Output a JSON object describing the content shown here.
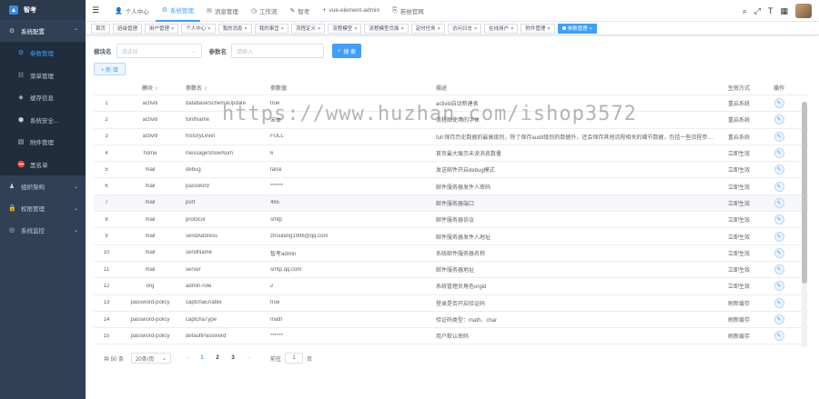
{
  "app": {
    "logo_text": "智考"
  },
  "sidebar": {
    "items": [
      {
        "label": "系统配置",
        "icon": "gear-icon",
        "type": "group-open"
      },
      {
        "label": "参数管理",
        "icon": "settings-icon",
        "type": "sub-active"
      },
      {
        "label": "菜单管理",
        "icon": "list-icon",
        "type": "sub"
      },
      {
        "label": "缓存信息",
        "icon": "cache-icon",
        "type": "sub"
      },
      {
        "label": "系统安全...",
        "icon": "shield-icon",
        "type": "sub"
      },
      {
        "label": "附件管理",
        "icon": "file-icon",
        "type": "sub"
      },
      {
        "label": "黑名单",
        "icon": "blacklist-icon",
        "type": "sub"
      },
      {
        "label": "组织架构",
        "icon": "org-icon",
        "type": "group"
      },
      {
        "label": "权限管理",
        "icon": "lock-icon",
        "type": "group"
      },
      {
        "label": "系统监控",
        "icon": "monitor-icon",
        "type": "group"
      }
    ]
  },
  "topnav": {
    "items": [
      {
        "label": "个人中心",
        "icon": "user-icon"
      },
      {
        "label": "系统管理",
        "icon": "gear-icon",
        "active": true
      },
      {
        "label": "消息管理",
        "icon": "message-icon"
      },
      {
        "label": "工作流",
        "icon": "workflow-icon"
      },
      {
        "label": "智考",
        "icon": "exam-icon"
      },
      {
        "label": "vue-element-admin",
        "icon": "plus-icon"
      },
      {
        "label": "若依官网",
        "icon": "link-icon"
      }
    ]
  },
  "tags": [
    {
      "label": "首页",
      "closable": false
    },
    {
      "label": "班级管理",
      "closable": false
    },
    {
      "label": "用户管理",
      "closable": true
    },
    {
      "label": "个人中心",
      "closable": true
    },
    {
      "label": "我的消息",
      "closable": true
    },
    {
      "label": "我的事宜",
      "closable": true
    },
    {
      "label": "流程定义",
      "closable": true
    },
    {
      "label": "流程模型",
      "closable": true
    },
    {
      "label": "流程模型页面",
      "closable": true
    },
    {
      "label": "定时任务",
      "closable": true
    },
    {
      "label": "访问日志",
      "closable": true
    },
    {
      "label": "在线用户",
      "closable": true
    },
    {
      "label": "附件管理",
      "closable": true
    },
    {
      "label": "参数管理",
      "closable": true,
      "active": true
    }
  ],
  "search": {
    "module_label": "模块名",
    "module_placeholder": "请选择",
    "param_label": "参数名",
    "param_placeholder": "请输入",
    "search_button": "搜 索"
  },
  "add_button": "+ 新 增",
  "table": {
    "columns": [
      "",
      "模块",
      "参数名",
      "参数值",
      "描述",
      "生效方式",
      "操作"
    ],
    "rows": [
      [
        "1",
        "activiti",
        "databaseSchemaUpdate",
        "true",
        "activiti自动新建表",
        "重启系统"
      ],
      [
        "2",
        "activiti",
        "fontName",
        "宋体",
        "流程图使用的字体",
        "重启系统"
      ],
      [
        "3",
        "activiti",
        "historyLevel",
        "FULL",
        "full:保存历史数据的最高级别，除了保存audit级别的数据外，还会保存其他流程相关的细节数据，包括一些流程参数等。",
        "重启系统"
      ],
      [
        "4",
        "home",
        "messageShowNum",
        "6",
        "首页最大展示未读消息数量",
        "立即生效"
      ],
      [
        "5",
        "mail",
        "debug",
        "false",
        "发送邮件开启debug模式",
        "立即生效"
      ],
      [
        "6",
        "mail",
        "password",
        "******",
        "邮件服务器发件人密码",
        "立即生效"
      ],
      [
        "7",
        "mail",
        "port",
        "465",
        "邮件服务器端口",
        "立即生效"
      ],
      [
        "8",
        "mail",
        "protocol",
        "smtp",
        "邮件服务器协议",
        "立即生效"
      ],
      [
        "9",
        "mail",
        "sendAddress",
        "zhoulang1996@qq.com",
        "邮件服务器发件人地址",
        "立即生效"
      ],
      [
        "10",
        "mail",
        "sendName",
        "智考admin",
        "系统邮件服务器名称",
        "立即生效"
      ],
      [
        "11",
        "mail",
        "server",
        "smtp.qq.com",
        "邮件服务器地址",
        "立即生效"
      ],
      [
        "12",
        "org",
        "admin-role",
        "2",
        "系统管理员角色orgid",
        "立即生效"
      ],
      [
        "13",
        "password-policy",
        "captchaEnable",
        "true",
        "登录是否开启验证码",
        "刷新缓存"
      ],
      [
        "14",
        "password-policy",
        "captchaType",
        "math",
        "验证码类型：math、char",
        "刷新缓存"
      ],
      [
        "15",
        "password-policy",
        "defaultPassword",
        "******",
        "用户默认密码",
        "刷新缓存"
      ]
    ]
  },
  "pagination": {
    "total": "共 50 条",
    "page_size": "20条/页",
    "pages": [
      "1",
      "2",
      "3"
    ],
    "current_page": "1",
    "goto_label": "前往",
    "goto_value": "1",
    "goto_suffix": "页"
  },
  "watermark": "https://www.huzhan.com/ishop3572"
}
